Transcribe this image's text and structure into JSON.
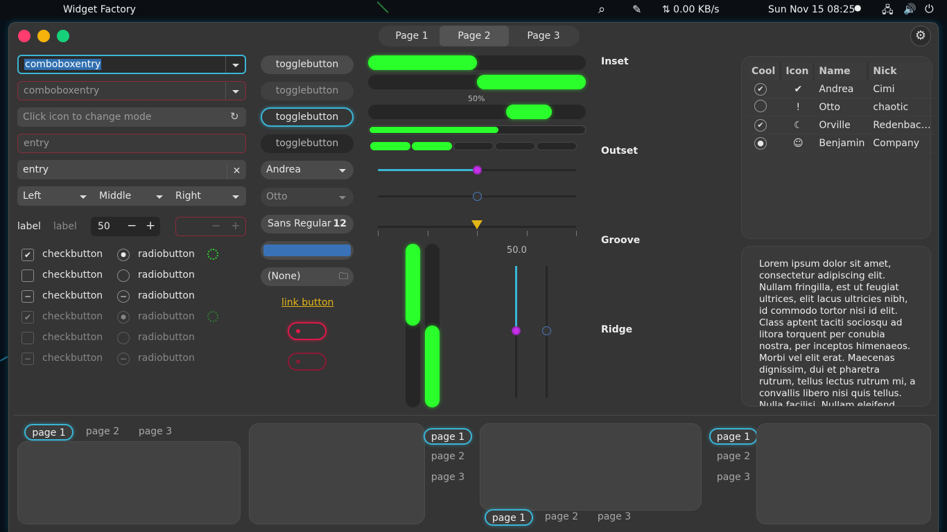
{
  "topbar": {
    "app_name": "Widget Factory",
    "net_speed": "⇅ 0.00 KB/s",
    "clock": "Sun Nov 15  08:25"
  },
  "window": {
    "header_tabs": [
      "Page 1",
      "Page 2",
      "Page 3"
    ],
    "active_header_tab": "Page 2"
  },
  "left": {
    "combo1_value": "comboboxentry",
    "combo2_placeholder": "comboboxentry",
    "mode_placeholder": "Click icon to change mode",
    "entry_placeholder": "entry",
    "entry_value": "entry",
    "segments": [
      "Left",
      "Middle",
      "Right"
    ],
    "label1": "label",
    "label2": "label",
    "spin_value": "50",
    "checks": [
      {
        "label": "checkbutton",
        "state": "checked"
      },
      {
        "label": "checkbutton",
        "state": "unchecked"
      },
      {
        "label": "checkbutton",
        "state": "mixed"
      },
      {
        "label": "checkbutton",
        "state": "checked"
      },
      {
        "label": "checkbutton",
        "state": "unchecked"
      },
      {
        "label": "checkbutton",
        "state": "mixed"
      }
    ],
    "radios": [
      {
        "label": "radiobutton",
        "state": "selected"
      },
      {
        "label": "radiobutton",
        "state": "unselected"
      },
      {
        "label": "radiobutton",
        "state": "mixed"
      },
      {
        "label": "radiobutton",
        "state": "selected"
      },
      {
        "label": "radiobutton",
        "state": "unselected"
      },
      {
        "label": "radiobutton",
        "state": "mixed"
      }
    ]
  },
  "middle": {
    "toggles": [
      "togglebutton",
      "togglebutton",
      "togglebutton",
      "togglebutton"
    ],
    "combo_andrea": "Andrea",
    "combo_otto": "Otto",
    "font_name": "Sans Regular",
    "font_size": "12",
    "file_chooser": "(None)",
    "link": "link button"
  },
  "progress": {
    "label": "50%",
    "bar1": 0.5,
    "bar2": 0.5,
    "level": 0.6,
    "segments_filled": 2,
    "segments_total": 5,
    "hslider1": 0.5,
    "hslider2": 0.5,
    "hslider3": 0.5,
    "vscale_value": "50.0",
    "color_accent": "#2bff2b"
  },
  "frames": [
    "Inset",
    "Outset",
    "Groove",
    "Ridge"
  ],
  "treeview": {
    "columns": [
      "Cool",
      "Icon",
      "Name",
      "Nick"
    ],
    "rows": [
      {
        "cool": "checked",
        "icon": "check-circle-icon",
        "glyph": "✔",
        "name": "Andrea",
        "nick": "Cimi"
      },
      {
        "cool": "unchecked",
        "icon": "warning-icon",
        "glyph": "!",
        "name": "Otto",
        "nick": "chaotic"
      },
      {
        "cool": "checked",
        "icon": "moon-icon",
        "glyph": "☾",
        "name": "Orville",
        "nick": "Redenbac…"
      },
      {
        "cool": "radio",
        "icon": "face-icon",
        "glyph": "☺",
        "name": "Benjamin",
        "nick": "Company"
      }
    ]
  },
  "textview": {
    "text": "Lorem ipsum dolor sit amet, consectetur adipiscing elit. Nullam fringilla, est ut feugiat ultrices, elit lacus ultricies nibh, id commodo tortor nisi id elit. Class aptent taciti sociosqu ad litora torquent per conubia nostra, per inceptos himenaeos. Morbi vel elit erat. Maecenas dignissim, dui et pharetra rutrum, tellus lectus rutrum mi, a convallis libero nisi quis tellus. Nulla facilisi. Nullam eleifend"
  },
  "notebooks": {
    "nb1_tabs": [
      "page 1",
      "page 2",
      "page 3"
    ],
    "nb2_tabs": [
      "page 1",
      "page 2",
      "page 3"
    ],
    "nb3_tabs": [
      "page 1",
      "page 2",
      "page 3"
    ],
    "nb4_tabs": [
      "page 1",
      "page 2",
      "page 3"
    ]
  }
}
